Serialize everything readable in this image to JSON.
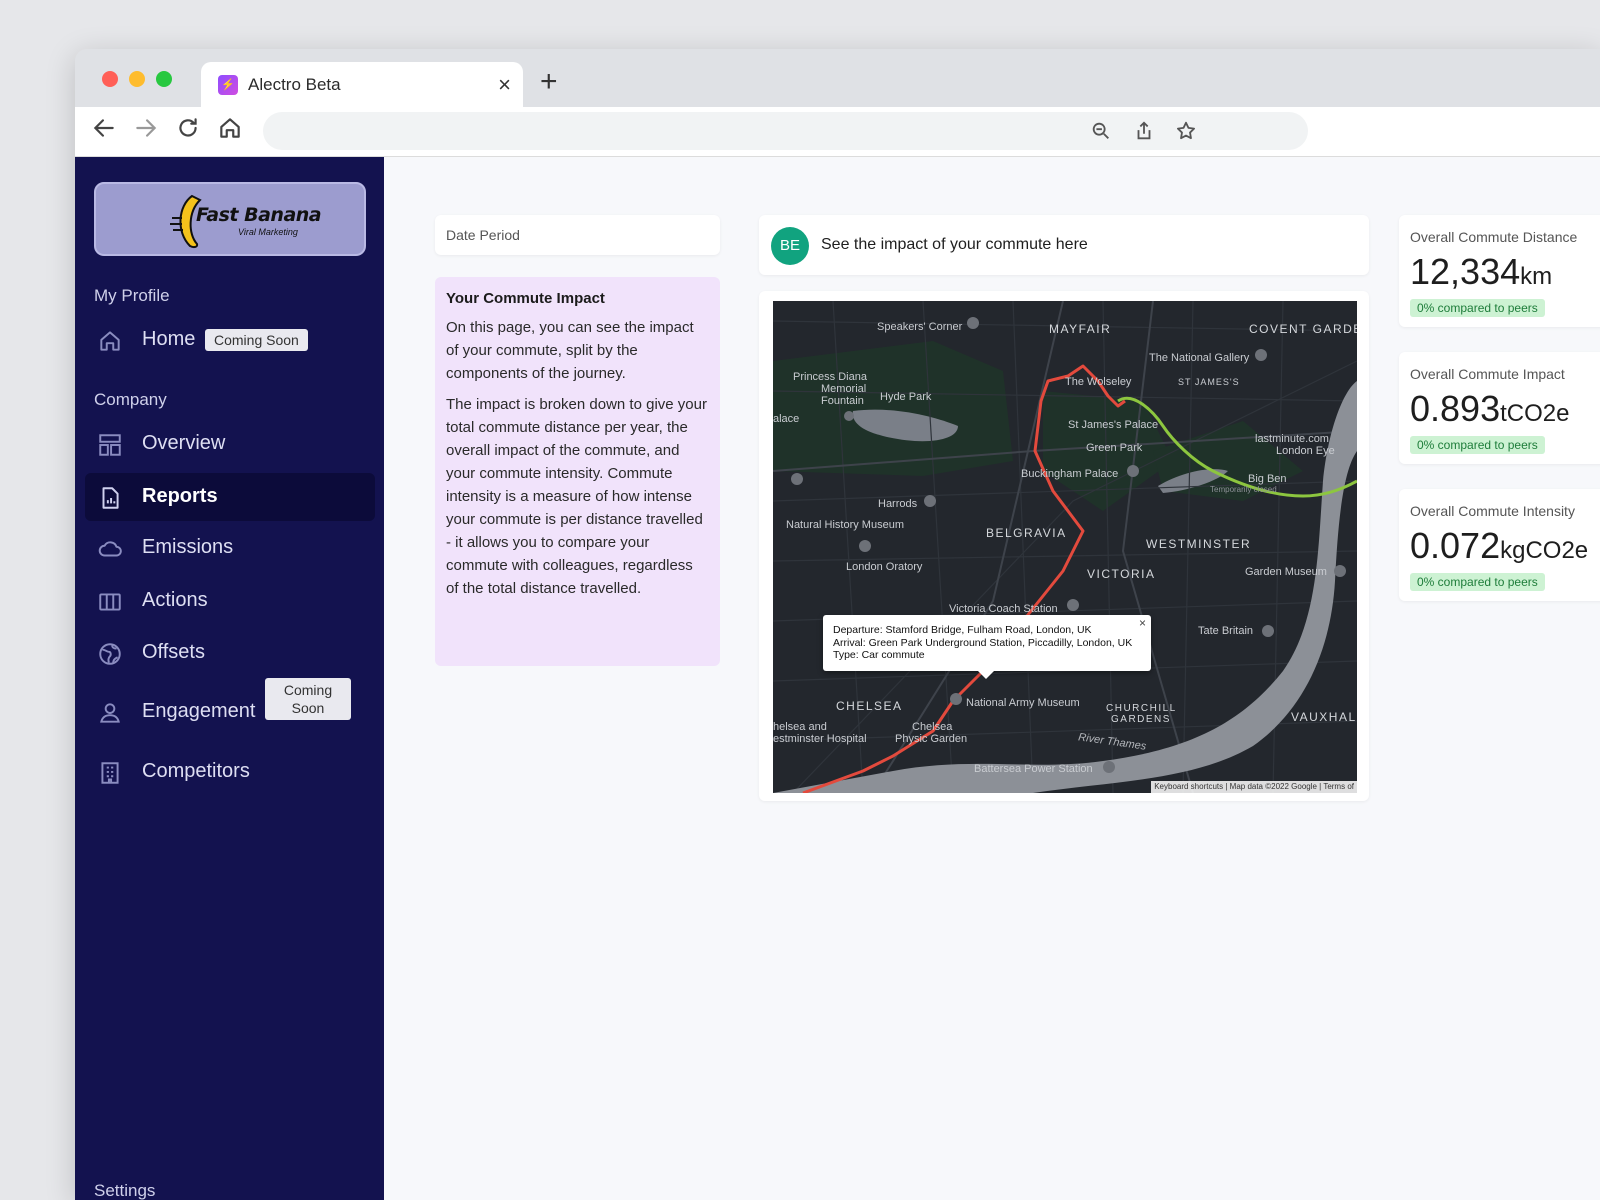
{
  "browser": {
    "tab_title": "Alectro Beta",
    "tab_close": "×",
    "new_tab": "+"
  },
  "logo": {
    "name": "Fast Banana",
    "tagline": "Viral Marketing"
  },
  "sidebar": {
    "section_profile": "My Profile",
    "section_company": "Company",
    "settings": "Settings",
    "items": [
      {
        "label": "Home",
        "icon": "home-icon",
        "badge": "Coming Soon"
      },
      {
        "label": "Overview",
        "icon": "dashboard-icon"
      },
      {
        "label": "Reports",
        "icon": "report-icon"
      },
      {
        "label": "Emissions",
        "icon": "cloud-icon"
      },
      {
        "label": "Actions",
        "icon": "columns-icon"
      },
      {
        "label": "Offsets",
        "icon": "globe-icon"
      },
      {
        "label": "Engagement",
        "icon": "users-icon",
        "badge_line1": "Coming",
        "badge_line2": "Soon"
      },
      {
        "label": "Competitors",
        "icon": "building-icon"
      }
    ]
  },
  "filters": {
    "date_period": "Date Period"
  },
  "impact": {
    "title": "Your Commute Impact",
    "p1": "On this page, you can see the impact of your commute, split by the components of the journey.",
    "p2": "The impact is broken down to give your total commute distance per year, the overall impact of the commute, and your commute intensity. Commute intensity is a measure of how intense your commute is per distance travelled - it allows you to compare your commute with colleagues, regardless of the total distance travelled."
  },
  "intro": {
    "avatar": "BE",
    "text": "See the impact of your commute here"
  },
  "map": {
    "labels": {
      "speakers_corner": "Speakers' Corner",
      "mayfair": "MAYFAIR",
      "covent_garden": "COVENT GARDEN",
      "national_gallery": "The National Gallery",
      "st_james": "ST JAMES'S",
      "diana1": "Princess Diana",
      "diana2": "Memorial",
      "diana3": "Fountain",
      "hyde_park": "Hyde Park",
      "wolseley": "The Wolseley",
      "palace": "alace",
      "st_james_palace": "St James's Palace",
      "london_eye1": "lastminute.com",
      "london_eye2": "London Eye",
      "green_park": "Green Park",
      "buckingham": "Buckingham Palace",
      "big_ben": "Big Ben",
      "temp_closed": "Temporarily closed",
      "harrods": "Harrods",
      "natural_history": "Natural History Museum",
      "belgravia": "BELGRAVIA",
      "westminster": "WESTMINSTER",
      "london_oratory": "London Oratory",
      "victoria": "VICTORIA",
      "garden_museum": "Garden Museum",
      "victoria_coach": "Victoria Coach Station",
      "tate_britain": "Tate Britain",
      "chelsea": "CHELSEA",
      "national_army": "National Army Museum",
      "churchill1": "CHURCHILL",
      "churchill2": "GARDENS",
      "vauxhall": "VAUXHALL",
      "chelsea_hosp1": "helsea and",
      "chelsea_hosp2": "estminster Hospital",
      "physic1": "Chelsea",
      "physic2": "Physic Garden",
      "battersea": "Battersea Power Station",
      "river": "River Thames"
    },
    "popup": {
      "departure": "Departure: Stamford Bridge, Fulham Road, London, UK",
      "arrival": "Arrival: Green Park Underground Station, Piccadilly, London, UK",
      "type": "Type: Car commute",
      "close": "×"
    },
    "attribution": "Keyboard shortcuts | Map data ©2022 Google | Terms of",
    "route_color": "#e34a3d",
    "alt_route_color": "#8dc63f"
  },
  "stats": [
    {
      "title": "Overall Commute Distance",
      "value": "12,334",
      "unit": "km",
      "badge": "0% compared to peers"
    },
    {
      "title": "Overall Commute Impact",
      "value": "0.893",
      "unit": "tCO2e",
      "badge": "0% compared to peers"
    },
    {
      "title": "Overall Commute Intensity",
      "value": "0.072",
      "unit": "kgCO2e",
      "badge": "0% compared to peers"
    }
  ]
}
